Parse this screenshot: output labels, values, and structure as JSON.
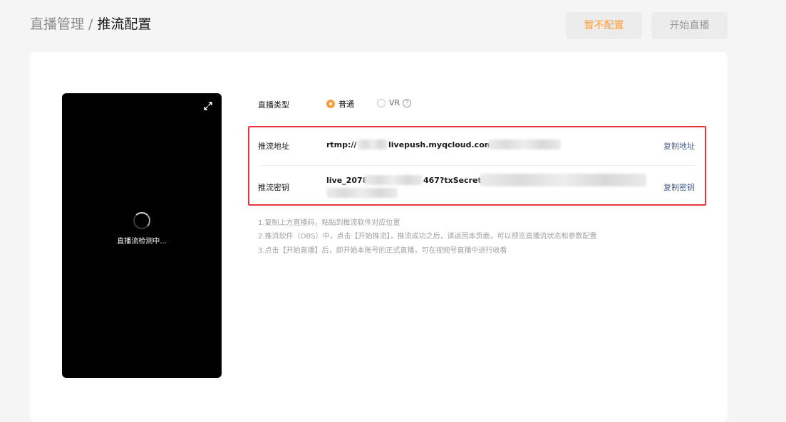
{
  "breadcrumb": {
    "parent": "直播管理",
    "separator": "/",
    "current": "推流配置"
  },
  "header": {
    "skip_button": "暂不配置",
    "start_button": "开始直播"
  },
  "preview": {
    "status_text": "直播流检测中..."
  },
  "live_type": {
    "label": "直播类型",
    "options": [
      "普通",
      "VR"
    ],
    "selected": "普通"
  },
  "push_url": {
    "label": "推流地址",
    "value_prefix": "rtmp://",
    "value_middle": "livepush.myqcloud.com/",
    "copy_label": "复制地址"
  },
  "push_key": {
    "label": "推流密钥",
    "value_prefix": "live_2078",
    "value_middle": "467?txSecret=",
    "copy_label": "复制密钥"
  },
  "tips": [
    "1.复制上方直播码，粘贴到推流软件对应位置",
    "2.推流软件（OBS）中，点击【开始推流】，推流成功之后，请返回本页面，可以预览直播流状态和参数配置",
    "3.点击【开始直播】后，即开始本账号的正式直播，可在视频号直播中进行收看"
  ],
  "colors": {
    "accent": "#fa9d3b",
    "highlight_border": "#e8363a",
    "link": "#4a5f8c"
  }
}
